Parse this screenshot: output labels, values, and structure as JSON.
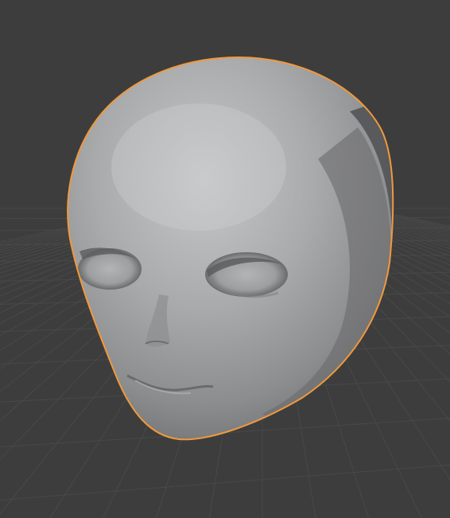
{
  "viewport": {
    "background_color": "#3d3d3d",
    "grid_color": "#4a4a4a",
    "selection_outline_color": "#f0993c",
    "mesh_base_color": "#9a9b9d",
    "mesh_highlight_color": "#c4c5c7",
    "mesh_shadow_color": "#5a5b5d",
    "object": "head-mesh",
    "selected": true
  }
}
